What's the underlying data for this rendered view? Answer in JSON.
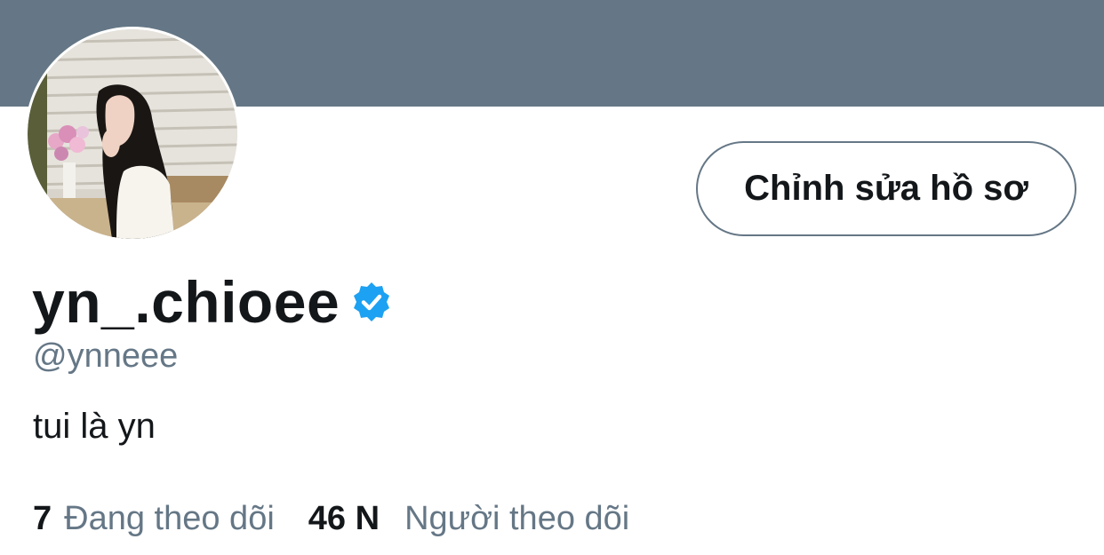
{
  "colors": {
    "banner": "#657786",
    "text_primary": "#14171a",
    "text_secondary": "#657786",
    "verified_badge": "#1da1f2",
    "button_border": "#657786"
  },
  "profile": {
    "display_name": "yn_.chioee",
    "handle": "@ynneee",
    "bio": "tui là yn",
    "verified_icon": "verified-badge-icon",
    "avatar_icon": "profile-photo"
  },
  "actions": {
    "edit_profile_label": "Chỉnh sửa hồ sơ"
  },
  "stats": {
    "following_count": "7",
    "following_label": "Đang theo dõi",
    "followers_count": "46 N",
    "followers_label": "Người theo dõi"
  }
}
